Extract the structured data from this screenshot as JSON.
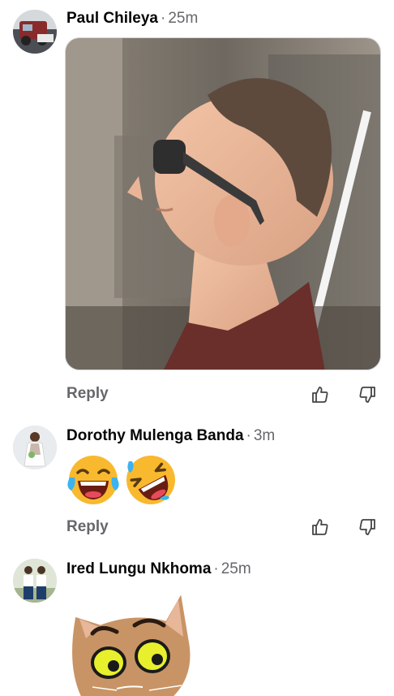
{
  "comments": [
    {
      "author": "Paul Chileya",
      "time": "25m",
      "reply_label": "Reply",
      "avatar_icon": "avatar-photo-vehicle",
      "attachment": "photo"
    },
    {
      "author": "Dorothy Mulenga Banda",
      "time": "3m",
      "reply_label": "Reply",
      "avatar_icon": "avatar-photo-person-white-dress",
      "emojis": [
        "face-with-tears-of-joy",
        "rolling-on-the-floor-laughing"
      ]
    },
    {
      "author": "Ired Lungu Nkhoma",
      "time": "25m",
      "avatar_icon": "avatar-photo-couple",
      "attachment": "cat-sticker"
    }
  ],
  "separator": "·",
  "icons": {
    "like": "thumbs-up-outline-icon",
    "dislike": "thumbs-down-outline-icon"
  },
  "colors": {
    "text": "#050505",
    "secondary": "#65676b",
    "emoji_yellow": "#f8b92f",
    "shirt": "#6a2f2a"
  }
}
